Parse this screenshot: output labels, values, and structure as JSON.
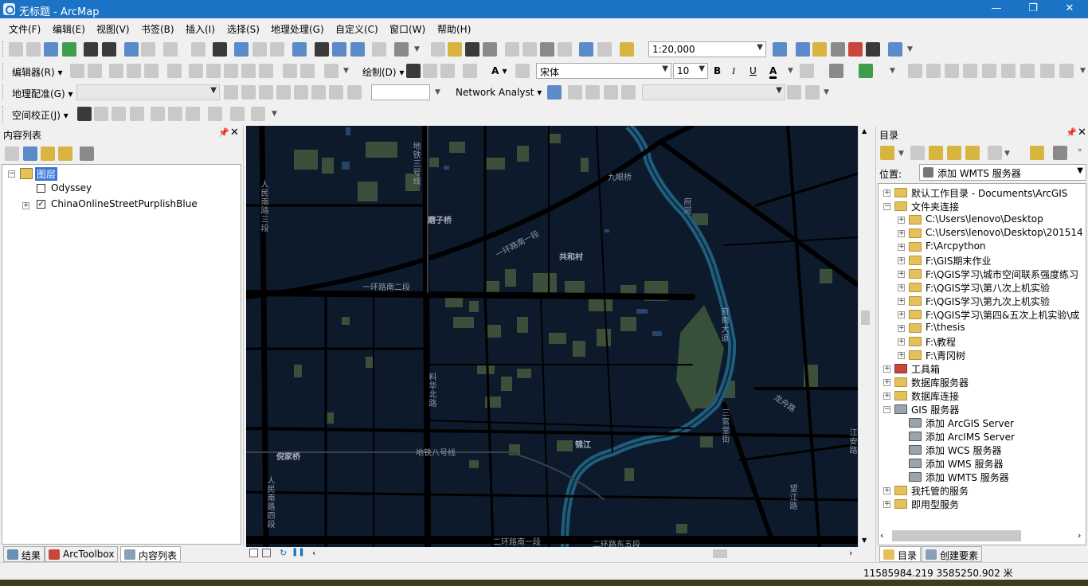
{
  "window": {
    "title": "无标题 - ArcMap",
    "minimize": "—",
    "maximize": "❐",
    "close": "✕"
  },
  "menu": [
    "文件(F)",
    "编辑(E)",
    "视图(V)",
    "书签(B)",
    "插入(I)",
    "选择(S)",
    "地理处理(G)",
    "自定义(C)",
    "窗口(W)",
    "帮助(H)"
  ],
  "toolbars": {
    "scale": "1:20,000",
    "editor_label": "编辑器(R)",
    "draw_label": "绘制(D)",
    "font": "宋体",
    "font_size": "10",
    "bold": "B",
    "italic": "I",
    "underline": "U",
    "font_color": "A",
    "georef_label": "地理配准(G)",
    "network_label": "Network Analyst",
    "spatial_adjust_label": "空间校正(J)"
  },
  "toc": {
    "title": "内容列表",
    "root": "图层",
    "layers": [
      {
        "name": "Odyssey",
        "checked": false
      },
      {
        "name": "ChinaOnlineStreetPurplishBlue",
        "checked": true
      }
    ],
    "tabs": [
      "结果",
      "ArcToolbox",
      "内容列表"
    ]
  },
  "map": {
    "labels": [
      "地铁三号线",
      "九眼桥",
      "磨子桥",
      "一环路南一段",
      "共和村",
      "一环路南二段",
      "府河",
      "府南大道",
      "料华北路",
      "人民南路三段",
      "人民南路四段",
      "倪家桥",
      "地铁八号线",
      "锦江",
      "江安路",
      "二环路东五段",
      "二环路南一段",
      "龙舟路",
      "三官堂街",
      "望江路"
    ],
    "colors": {
      "background": "#0d1a2c",
      "roads": "#000000",
      "river": "#1f5c7d",
      "buildings": "#3b4f3a",
      "blocks": "#2c4a6f"
    }
  },
  "catalog": {
    "title": "目录",
    "location_label": "位置:",
    "location_value": "添加 WMTS 服务器",
    "items": [
      {
        "label": "默认工作目录 - Documents\\ArcGIS",
        "level": 0,
        "expander": "+"
      },
      {
        "label": "文件夹连接",
        "level": 0,
        "expander": "−"
      },
      {
        "label": "C:\\Users\\lenovo\\Desktop",
        "level": 1,
        "expander": "+"
      },
      {
        "label": "C:\\Users\\lenovo\\Desktop\\201514",
        "level": 1,
        "expander": "+"
      },
      {
        "label": "F:\\Arcpython",
        "level": 1,
        "expander": "+"
      },
      {
        "label": "F:\\GIS期末作业",
        "level": 1,
        "expander": "+"
      },
      {
        "label": "F:\\QGIS学习\\城市空间联系强度练习",
        "level": 1,
        "expander": "+"
      },
      {
        "label": "F:\\QGIS学习\\第八次上机实验",
        "level": 1,
        "expander": "+"
      },
      {
        "label": "F:\\QGIS学习\\第九次上机实验",
        "level": 1,
        "expander": "+"
      },
      {
        "label": "F:\\QGIS学习\\第四&五次上机实验\\成",
        "level": 1,
        "expander": "+"
      },
      {
        "label": "F:\\thesis",
        "level": 1,
        "expander": "+"
      },
      {
        "label": "F:\\教程",
        "level": 1,
        "expander": "+"
      },
      {
        "label": "F:\\青冈树",
        "level": 1,
        "expander": "+"
      },
      {
        "label": "工具箱",
        "level": 0,
        "expander": "+"
      },
      {
        "label": "数据库服务器",
        "level": 0,
        "expander": "+"
      },
      {
        "label": "数据库连接",
        "level": 0,
        "expander": "+"
      },
      {
        "label": "GIS 服务器",
        "level": 0,
        "expander": "−"
      },
      {
        "label": "添加 ArcGIS Server",
        "level": 1,
        "expander": ""
      },
      {
        "label": "添加 ArcIMS Server",
        "level": 1,
        "expander": ""
      },
      {
        "label": "添加 WCS 服务器",
        "level": 1,
        "expander": ""
      },
      {
        "label": "添加 WMS 服务器",
        "level": 1,
        "expander": ""
      },
      {
        "label": "添加 WMTS 服务器",
        "level": 1,
        "expander": ""
      },
      {
        "label": "我托管的服务",
        "level": 0,
        "expander": "+"
      },
      {
        "label": "即用型服务",
        "level": 0,
        "expander": "+"
      }
    ],
    "tabs": [
      "目录",
      "创建要素"
    ]
  },
  "status": {
    "coordinates": "11585984.219  3585250.902 米"
  }
}
